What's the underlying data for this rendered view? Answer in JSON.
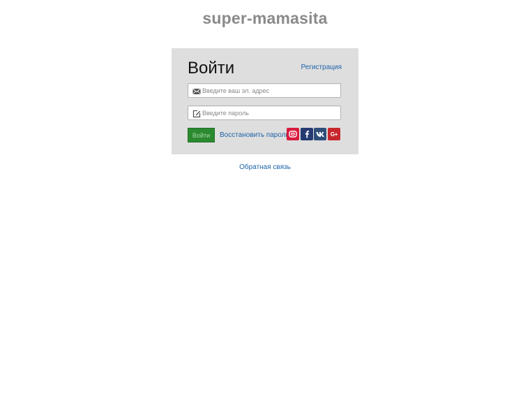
{
  "site": {
    "title": "super-mamasita"
  },
  "login": {
    "title": "Войти",
    "register_label": "Регистрация",
    "email": {
      "value": "",
      "placeholder": "Введите ваш эл. адрес",
      "icon": "envelope-icon"
    },
    "password": {
      "value": "",
      "placeholder": "Введите пароль",
      "icon": "edit-icon"
    },
    "submit_label": "Войти",
    "restore_label": "Восстановить пароль",
    "social": [
      {
        "name": "mail-ru",
        "icon": "mail-ru-icon",
        "color": "#d81c3f"
      },
      {
        "name": "facebook",
        "icon": "facebook-icon",
        "color": "#263a72"
      },
      {
        "name": "vkontakte",
        "icon": "vk-icon",
        "color": "#2e4e7a"
      },
      {
        "name": "google-plus",
        "icon": "google-plus-icon",
        "color": "#c7262c",
        "label": "G+"
      }
    ]
  },
  "footer": {
    "feedback_label": "Обратная связь"
  },
  "colors": {
    "card_bg": "#dedede",
    "link": "#1e63a8",
    "submit_bg": "#2b8a2f",
    "title_gray": "#8a8a8a"
  }
}
